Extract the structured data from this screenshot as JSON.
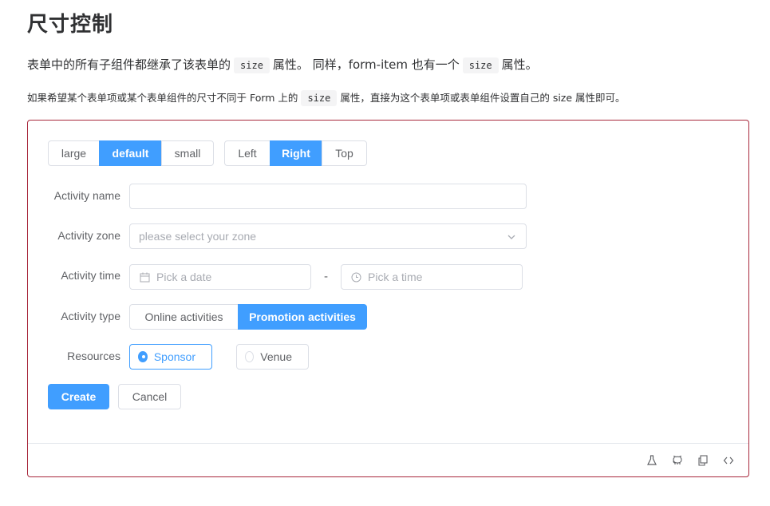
{
  "page": {
    "title": "尺寸控制",
    "desc1_pre": "表单中的所有子组件都继承了该表单的",
    "desc1_code1": "size",
    "desc1_mid": "属性。 同样，form-item 也有一个",
    "desc1_code2": "size",
    "desc1_post": "属性。",
    "desc2_pre": "如果希望某个表单项或某个表单组件的尺寸不同于 Form 上的",
    "desc2_code": "size",
    "desc2_post": "属性，直接为这个表单项或表单组件设置自己的 size 属性即可。"
  },
  "size_toggle": {
    "options": [
      "large",
      "default",
      "small"
    ],
    "selected": "default"
  },
  "position_toggle": {
    "options": [
      "Left",
      "Right",
      "Top"
    ],
    "selected": "Right"
  },
  "form": {
    "name_label": "Activity name",
    "name_value": "",
    "zone_label": "Activity zone",
    "zone_placeholder": "please select your zone",
    "time_label": "Activity time",
    "date_placeholder": "Pick a date",
    "time_separator": "-",
    "time_placeholder": "Pick a time",
    "type_label": "Activity type",
    "type_options": [
      "Online activities",
      "Promotion activities"
    ],
    "type_selected": "Promotion activities",
    "resources_label": "Resources",
    "resources_options": [
      "Sponsor",
      "Venue"
    ],
    "resources_selected": "Sponsor",
    "create_label": "Create",
    "cancel_label": "Cancel"
  },
  "footer_icons": [
    "flask-icon",
    "github-icon",
    "copy-icon",
    "code-icon"
  ],
  "colors": {
    "primary": "#409eff",
    "demo_border": "#a8283c"
  }
}
